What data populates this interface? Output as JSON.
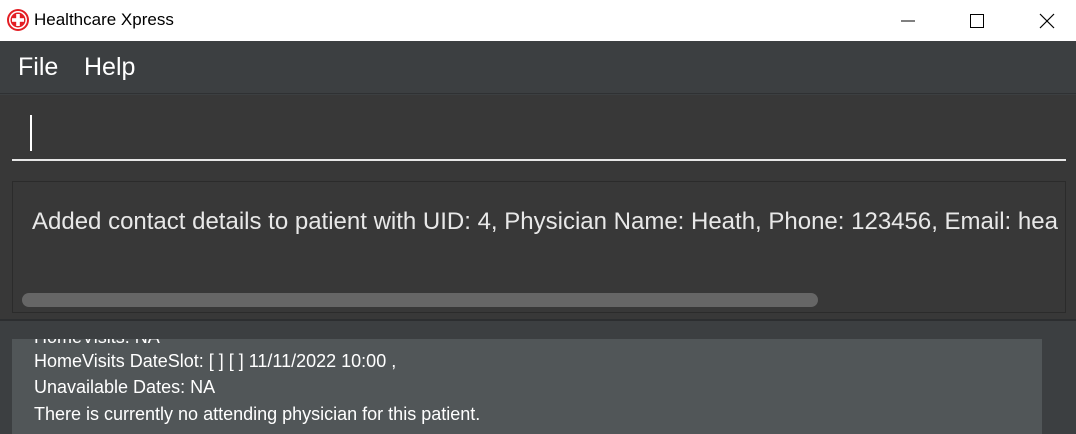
{
  "window": {
    "title": "Healthcare Xpress"
  },
  "menu": {
    "file": "File",
    "help": "Help"
  },
  "command": {
    "value": ""
  },
  "result": {
    "text": "Added contact details to patient with UID: 4, Physician Name: Heath, Phone: 123456, Email: hea"
  },
  "patient_card": {
    "lines": [
      "HomeVisits: NA",
      "HomeVisits DateSlot: [ ] [ ] 11/11/2022 10:00 ,",
      "Unavailable Dates: NA",
      "There is currently no attending physician for this patient."
    ]
  },
  "colors": {
    "background": "#3c3f41",
    "card": "#515658",
    "app_icon_red": "#e31e24"
  },
  "icons": [
    "red-cross-app-icon",
    "minimize-icon",
    "maximize-icon",
    "close-icon"
  ]
}
